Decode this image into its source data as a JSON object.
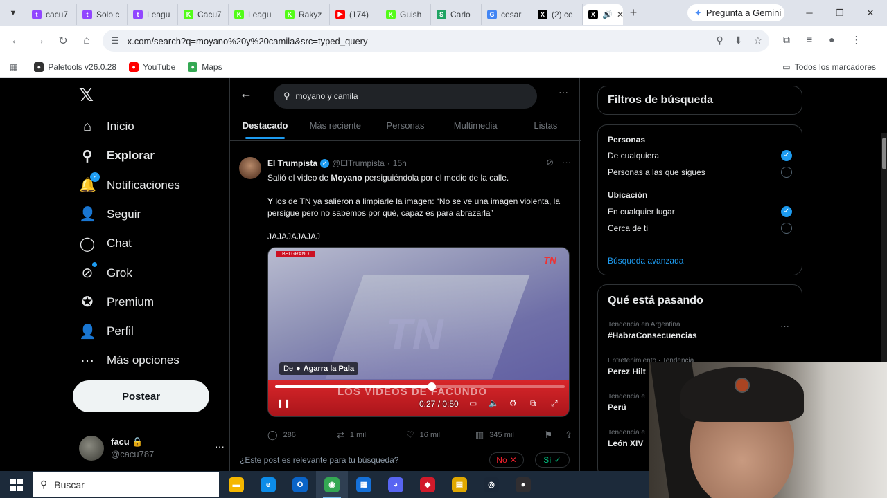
{
  "browser": {
    "tabs": [
      {
        "label": "cacu7",
        "icon": "twitch-icon",
        "color": "#9146ff",
        "glyph": "t"
      },
      {
        "label": "Solo c",
        "icon": "twitch-icon",
        "color": "#9146ff",
        "glyph": "t"
      },
      {
        "label": "Leagu",
        "icon": "twitch-icon",
        "color": "#9146ff",
        "glyph": "t"
      },
      {
        "label": "Cacu7",
        "icon": "kick-icon",
        "color": "#53fc18",
        "glyph": "K"
      },
      {
        "label": "Leagu",
        "icon": "kick-icon",
        "color": "#53fc18",
        "glyph": "K"
      },
      {
        "label": "Rakyz",
        "icon": "kick-icon",
        "color": "#53fc18",
        "glyph": "K"
      },
      {
        "label": "(174)",
        "icon": "youtube-icon",
        "color": "#ff0000",
        "glyph": "▶"
      },
      {
        "label": "Guish",
        "icon": "kick-icon",
        "color": "#53fc18",
        "glyph": "K"
      },
      {
        "label": "Carlo",
        "icon": "sheets-icon",
        "color": "#1fa463",
        "glyph": "S"
      },
      {
        "label": "cesar",
        "icon": "google-icon",
        "color": "#4285f4",
        "glyph": "G"
      },
      {
        "label": "(2) ce",
        "icon": "x-icon",
        "color": "#000000",
        "glyph": "X"
      }
    ],
    "active_tab": {
      "icon": "x-icon",
      "sound_icon": "speaker-icon",
      "close": "✕"
    },
    "gemini_label": "Pregunta a Gemini",
    "url": "x.com/search?q=moyano%20y%20camila&src=typed_query",
    "bookmarks": [
      {
        "label": "Paletools v26.0.28",
        "icon": "paletools-icon",
        "color": "#333333"
      },
      {
        "label": "YouTube",
        "icon": "youtube-icon",
        "color": "#ff0000"
      },
      {
        "label": "Maps",
        "icon": "maps-pin-icon",
        "color": "#34a853"
      }
    ],
    "all_bookmarks": "Todos los marcadores"
  },
  "nav": {
    "items": [
      {
        "label": "Inicio",
        "icon": "home-icon",
        "glyph": "⌂"
      },
      {
        "label": "Explorar",
        "icon": "search-icon",
        "glyph": "⚲"
      },
      {
        "label": "Notificaciones",
        "icon": "bell-icon",
        "glyph": "🔔",
        "badge": "2"
      },
      {
        "label": "Seguir",
        "icon": "follow-icon",
        "glyph": "👤"
      },
      {
        "label": "Chat",
        "icon": "chat-icon",
        "glyph": "◯"
      },
      {
        "label": "Grok",
        "icon": "grok-icon",
        "glyph": "⊘"
      },
      {
        "label": "Premium",
        "icon": "premium-icon",
        "glyph": "✪"
      },
      {
        "label": "Perfil",
        "icon": "person-icon",
        "glyph": "👤"
      },
      {
        "label": "Más opciones",
        "icon": "more-circle-icon",
        "glyph": "⋯"
      }
    ],
    "post_label": "Postear",
    "profile": {
      "name": "facu",
      "lock": "🔒",
      "handle": "@cacu787"
    }
  },
  "main": {
    "search_query": "moyano y camila",
    "tabs": [
      "Destacado",
      "Más reciente",
      "Personas",
      "Multimedia",
      "Listas"
    ],
    "tweet": {
      "name": "El Trumpista",
      "handle": "@ElTrumpista",
      "sep": "·",
      "time": "15h",
      "line1_pre": "Salió el video de ",
      "line1_bold": "Moyano",
      "line1_post": " persiguiéndola por el medio de la calle.",
      "line2_bold": "Y",
      "line2_rest": " los de TN ya salieron a limpiarle la imagen: “No se ve una imagen violenta, la persigue pero no sabemos por qué, capaz es para abrazarla”",
      "line3": "JAJAJAJAJAJ",
      "video": {
        "location": "BELGRANO",
        "brand": "TN",
        "watermark": "TN",
        "channel_prefix": "De",
        "channel": "Agarra la Pala",
        "lower_third": "LOS VIDEOS DE FACUNDO",
        "time": "0:27 / 0:50",
        "progress": 0.54
      },
      "stats": {
        "replies": "286",
        "reposts": "1 mil",
        "likes": "16 mil",
        "views": "345 mil"
      }
    },
    "relevance": {
      "question": "¿Este post es relevante para tu búsqueda?",
      "no": "No",
      "yes": "Sí"
    }
  },
  "sidebar": {
    "filters_title": "Filtros de búsqueda",
    "people_label": "Personas",
    "people_opts": [
      {
        "label": "De cualquiera",
        "on": true
      },
      {
        "label": "Personas a las que sigues",
        "on": false
      }
    ],
    "location_label": "Ubicación",
    "location_opts": [
      {
        "label": "En cualquier lugar",
        "on": true
      },
      {
        "label": "Cerca de ti",
        "on": false
      }
    ],
    "advanced": "Búsqueda avanzada",
    "trends_title": "Qué está pasando",
    "trends": [
      {
        "context": "Tendencia en Argentina",
        "name": "#HabraConsecuencias"
      },
      {
        "context": "Entretenimiento · Tendencia",
        "name": "Perez Hilt"
      },
      {
        "context": "Tendencia e",
        "name": "Perú"
      },
      {
        "context": "Tendencia e",
        "name": "León XIV"
      }
    ]
  },
  "taskbar": {
    "search_placeholder": "Buscar",
    "apps": [
      {
        "name": "file-explorer-icon",
        "color": "#f5b700",
        "glyph": "▬"
      },
      {
        "name": "edge-icon",
        "color": "#0c8ce9",
        "glyph": "e"
      },
      {
        "name": "outlook-icon",
        "color": "#0a64c8",
        "glyph": "O"
      },
      {
        "name": "chrome-icon",
        "color": "#34a853",
        "glyph": "◉"
      },
      {
        "name": "store-icon",
        "color": "#1570d8",
        "glyph": "▦"
      },
      {
        "name": "discord-icon",
        "color": "#5865f2",
        "glyph": "◕"
      },
      {
        "name": "app-red-icon",
        "color": "#d11a2a",
        "glyph": "◆"
      },
      {
        "name": "notes-icon",
        "color": "#e0a800",
        "glyph": "▤"
      },
      {
        "name": "steam-icon",
        "color": "#1b2838",
        "glyph": "◎"
      },
      {
        "name": "obs-icon",
        "color": "#302e31",
        "glyph": "●"
      }
    ]
  }
}
